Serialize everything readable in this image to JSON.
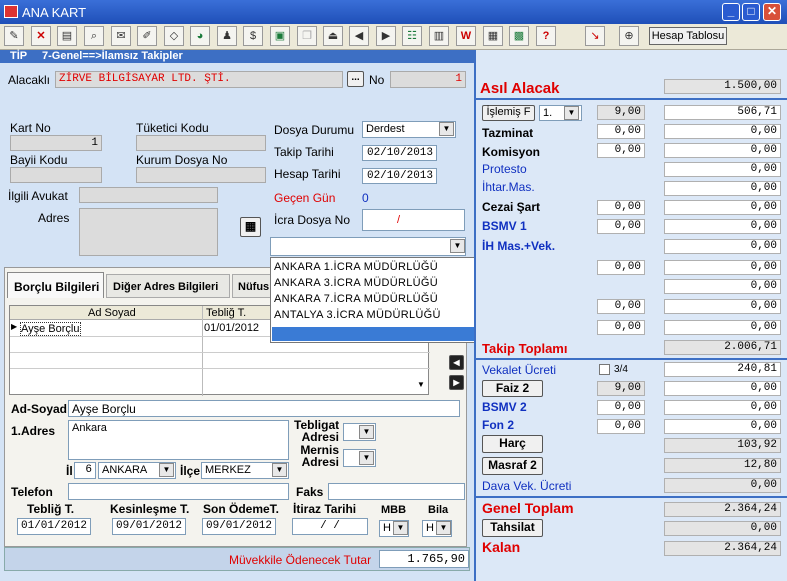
{
  "window": {
    "title": "ANA KART"
  },
  "toolbar": {
    "hesap_tablosu": "Hesap Tablosu"
  },
  "header": {
    "tip_label": "TİP",
    "tip_value": "7-Genel==>İlamsız Takipler"
  },
  "alacakli": {
    "label": "Alacaklı",
    "value": "ZİRVE BİLGİSAYAR LTD. ŞTİ.",
    "browse": "...",
    "no_label": "No",
    "no_value": "1"
  },
  "fields": {
    "kart_no_label": "Kart No",
    "kart_no": "1",
    "tuketici_label": "Tüketici Kodu",
    "bayii_label": "Bayii Kodu",
    "kurum_label": "Kurum Dosya No",
    "avukat_label": "İlgili Avukat",
    "adres_label": "Adres"
  },
  "dosya": {
    "durum_label": "Dosya Durumu",
    "durum_value": "Derdest",
    "takip_label": "Takip Tarihi",
    "takip_value": "02/10/2013",
    "hesap_label": "Hesap Tarihi",
    "hesap_value": "02/10/2013",
    "gecen_label": "Geçen Gün",
    "gecen_value": "0",
    "icra_label": "İcra Dosya No",
    "icra_value": "/"
  },
  "icra_list": [
    "ANKARA 1.İCRA MÜDÜRLÜĞÜ",
    "ANKARA 3.İCRA MÜDÜRLÜĞÜ",
    "ANKARA 7.İCRA MÜDÜRLÜĞÜ",
    "ANTALYA 3.İCRA MÜDÜRLÜĞÜ"
  ],
  "tabs": {
    "borclu": "Borçlu Bilgileri",
    "diger": "Diğer Adres Bilgileri",
    "nufus": "Nüfus"
  },
  "grid": {
    "col_ad": "Ad Soyad",
    "col_teblig": "Tebliğ T.",
    "row1_ad": "Ayşe Borçlu",
    "row1_teblig": "01/01/2012"
  },
  "borclu": {
    "adsoyad_label": "Ad-Soyad",
    "adsoyad": "Ayşe Borçlu",
    "adres_label": "1.Adres",
    "adres": "Ankara",
    "teblig_adres": "Tebligat Adresi",
    "mernis_adres": "Mernis Adresi",
    "il_label": "İl",
    "il_code": "6",
    "il": "ANKARA",
    "ilce_label": "İlçe",
    "ilce": "MERKEZ",
    "telefon_label": "Telefon",
    "faks_label": "Faks",
    "teblig_t_label": "Tebliğ T.",
    "teblig_t": "01/01/2012",
    "kesin_label": "Kesinleşme T.",
    "kesin": "09/01/2012",
    "son_label": "Son ÖdemeT.",
    "son": "09/01/2012",
    "itiraz_label": "İtiraz Tarihi",
    "itiraz": "/ /",
    "mbb_label": "MBB",
    "mbb": "H",
    "bila_label": "Bila",
    "bila": "H"
  },
  "footer": {
    "muvekkil_label": "Müvekkile Ödenecek Tutar",
    "muvekkil": "1.765,90"
  },
  "right": {
    "asil_label": "Asıl Alacak",
    "asil": "1.500,00",
    "islemis_label": "İşlemiş F",
    "islemis_sel": "1.",
    "islemis_rate": "9,00",
    "islemis": "506,71",
    "tazminat_label": "Tazminat",
    "tazminat_rate": "0,00",
    "tazminat": "0,00",
    "komisyon_label": "Komisyon",
    "komisyon_rate": "0,00",
    "komisyon": "0,00",
    "protesto_label": "Protesto",
    "protesto": "0,00",
    "ihtar_label": "İhtar.Mas.",
    "ihtar": "0,00",
    "cezai_label": "Cezai Şart",
    "cezai_rate": "0,00",
    "cezai": "0,00",
    "bsmv1_label": "BSMV 1",
    "bsmv1_rate": "0,00",
    "bsmv1": "0,00",
    "ihmas_label": "İH Mas.+Vek.",
    "ihmas": "0,00",
    "r10_rate": "0,00",
    "r10": "0,00",
    "r11": "0,00",
    "r12_rate": "0,00",
    "r12": "0,00",
    "r13_rate": "0,00",
    "r13": "0,00",
    "takip_label": "Takip Toplamı",
    "takip": "2.006,71",
    "vekalet_label": "Vekalet Ücreti",
    "vekalet_frac": "3/4",
    "vekalet": "240,81",
    "faiz2_label": "Faiz 2",
    "faiz2_rate": "9,00",
    "faiz2": "0,00",
    "bsmv2_label": "BSMV 2",
    "bsmv2_rate": "0,00",
    "bsmv2": "0,00",
    "fon2_label": "Fon 2",
    "fon2_rate": "0,00",
    "fon2": "0,00",
    "harc_label": "Harç",
    "harc": "103,92",
    "masraf_label": "Masraf 2",
    "masraf": "12,80",
    "davavek_label": "Dava Vek. Ücreti",
    "davavek": "0,00",
    "genel_label": "Genel Toplam",
    "genel": "2.364,24",
    "tahsilat_label": "Tahsilat",
    "tahsilat": "0,00",
    "kalan_label": "Kalan",
    "kalan": "2.364,24"
  }
}
